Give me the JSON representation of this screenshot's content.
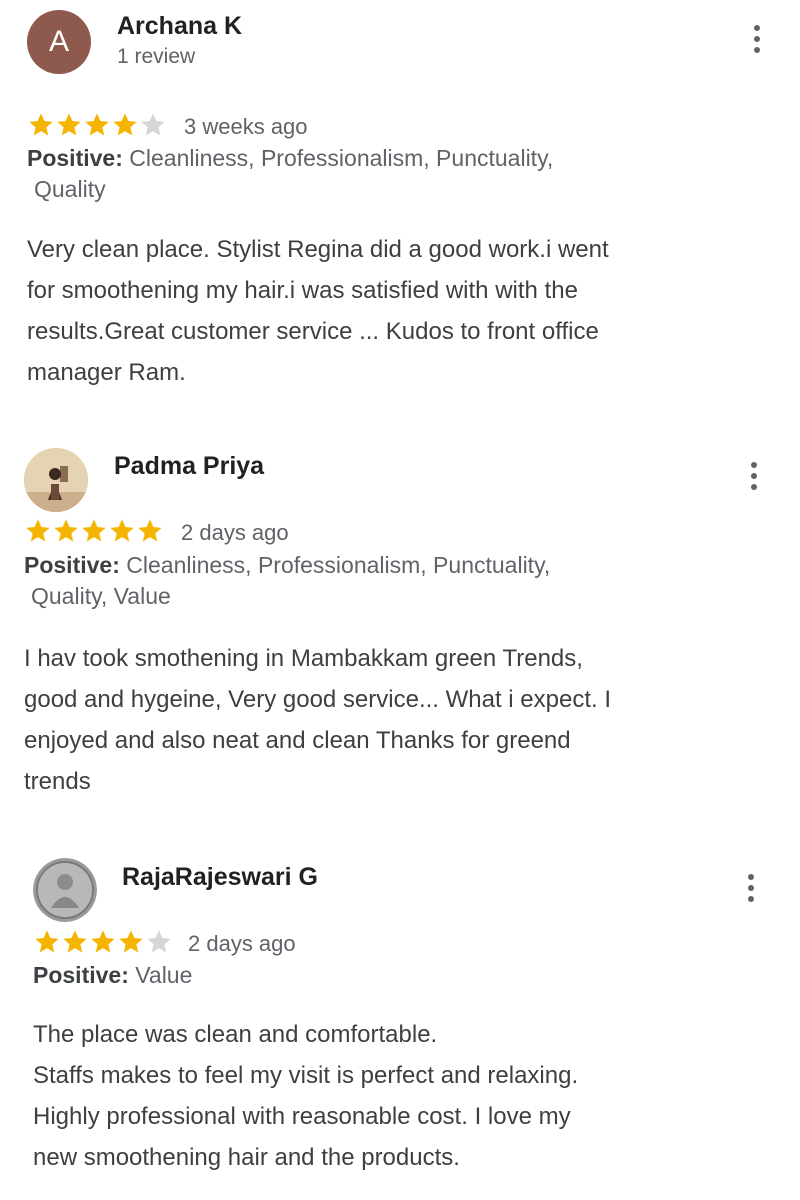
{
  "colors": {
    "star_filled": "#f5b400",
    "star_empty": "#d6d6d6",
    "avatar_letter_bg": "#8d5a4d"
  },
  "reviews": [
    {
      "avatar_letter": "A",
      "avatar_type": "letter",
      "name": "Archana K",
      "subtitle": "1 review",
      "rating": 4,
      "date": "3 weeks ago",
      "positive_label": "Positive:",
      "positive_line1": "Cleanliness, Professionalism, Punctuality,",
      "positive_line2": "Quality",
      "text_lines": [
        "Very clean place. Stylist Regina did a good work.i went",
        "for smoothening my hair.i was satisfied with with the",
        "results.Great customer service ... Kudos to front office",
        "manager Ram."
      ],
      "more_icon": "more-vertical-icon"
    },
    {
      "avatar_type": "photo",
      "name": "Padma Priya",
      "rating": 5,
      "date": "2 days ago",
      "positive_label": "Positive:",
      "positive_line1": "Cleanliness, Professionalism, Punctuality,",
      "positive_line2": "Quality, Value",
      "text_lines": [
        "I hav took smothening in Mambakkam green Trends,",
        "good and hygeine, Very good service... What i expect. I",
        "enjoyed and also neat and clean Thanks for greend",
        "trends"
      ],
      "more_icon": "more-vertical-icon"
    },
    {
      "avatar_type": "photo",
      "name": "RajaRajeswari G",
      "rating": 4,
      "date": "2 days ago",
      "positive_label": "Positive:",
      "positive_line1": "Value",
      "text_lines": [
        "The place was clean and comfortable.",
        "Staffs makes to feel my visit is perfect and relaxing.",
        "Highly professional with reasonable cost. I love my",
        "new smoothening hair and the products."
      ],
      "more_icon": "more-vertical-icon"
    }
  ]
}
